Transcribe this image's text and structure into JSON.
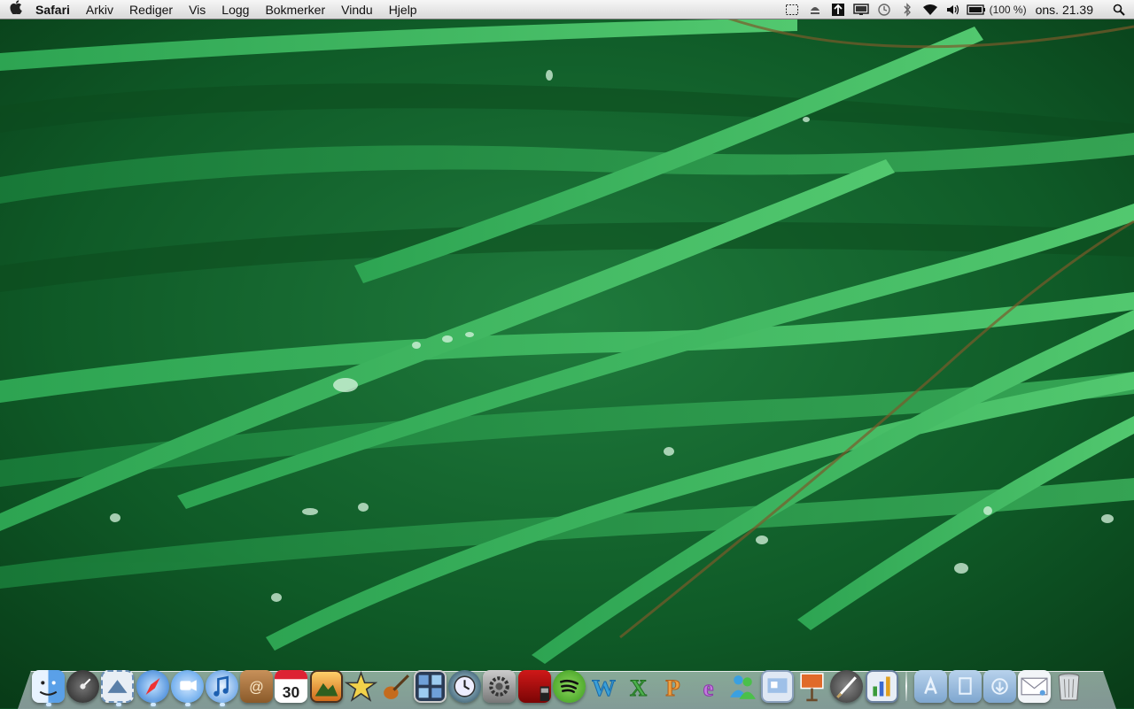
{
  "menubar": {
    "apple_icon": "apple-icon",
    "app_name": "Safari",
    "menus": [
      "Arkiv",
      "Rediger",
      "Vis",
      "Logg",
      "Bokmerker",
      "Vindu",
      "Hjelp"
    ],
    "status_icons": [
      "screen-capture-icon",
      "eject-icon",
      "dropbox-icon",
      "display-icon",
      "time-machine-icon",
      "bluetooth-icon",
      "wifi-icon",
      "volume-icon",
      "battery-icon"
    ],
    "battery_percent": "(100 %)",
    "clock": "ons. 21.39",
    "spotlight_icon": "spotlight-icon"
  },
  "dock": {
    "apps": [
      {
        "name": "finder",
        "icon": "finder-icon",
        "color": "#3d8fe0"
      },
      {
        "name": "dashboard",
        "icon": "dashboard-icon",
        "color": "#3a3a3a"
      },
      {
        "name": "mail",
        "icon": "mail-stamp-icon",
        "color": "#7da1c9"
      },
      {
        "name": "safari",
        "icon": "safari-compass-icon",
        "color": "#4b8ed8"
      },
      {
        "name": "ichat",
        "icon": "ichat-icon",
        "color": "#5fa6f0"
      },
      {
        "name": "itunes",
        "icon": "itunes-icon",
        "color": "#3c86d8"
      },
      {
        "name": "address-book",
        "icon": "address-book-icon",
        "color": "#b67d3a"
      },
      {
        "name": "ical",
        "icon": "calendar-icon",
        "color": "#e8e8e8",
        "label": "30"
      },
      {
        "name": "iphoto",
        "icon": "iphoto-icon",
        "color": "#7a5230"
      },
      {
        "name": "imovie",
        "icon": "imovie-star-icon",
        "color": "#5c4a2a"
      },
      {
        "name": "garageband",
        "icon": "guitar-icon",
        "color": "#b66a1e"
      },
      {
        "name": "spaces",
        "icon": "spaces-icon",
        "color": "#3a4f6f"
      },
      {
        "name": "time-machine",
        "icon": "time-machine-icon",
        "color": "#2f6b8f"
      },
      {
        "name": "system-preferences",
        "icon": "system-preferences-icon",
        "color": "#8a8a8a"
      },
      {
        "name": "photo-booth",
        "icon": "photo-booth-icon",
        "color": "#b01515"
      },
      {
        "name": "spotify",
        "icon": "spotify-icon",
        "color": "#5ab22e"
      },
      {
        "name": "word",
        "icon": "word-icon",
        "color": "#45a8d8"
      },
      {
        "name": "excel",
        "icon": "excel-icon",
        "color": "#4cb04c"
      },
      {
        "name": "powerpoint",
        "icon": "powerpoint-icon",
        "color": "#e48a2a"
      },
      {
        "name": "entourage",
        "icon": "entourage-icon",
        "color": "#b06ad0"
      },
      {
        "name": "messenger",
        "icon": "messenger-icon",
        "color": "#2e8fd6"
      },
      {
        "name": "preview-image",
        "icon": "preview-icon",
        "color": "#9fb6d3"
      },
      {
        "name": "keynote",
        "icon": "keynote-icon",
        "color": "#c75a2a"
      },
      {
        "name": "script-editor",
        "icon": "script-editor-icon",
        "color": "#404040"
      },
      {
        "name": "numbers",
        "icon": "numbers-icon",
        "color": "#3d6ec4"
      }
    ],
    "stacks": [
      {
        "name": "applications-folder",
        "icon": "applications-folder-icon",
        "color": "#8fb3d6"
      },
      {
        "name": "documents-folder",
        "icon": "documents-folder-icon",
        "color": "#8fb3d6"
      },
      {
        "name": "downloads-folder",
        "icon": "downloads-folder-icon",
        "color": "#8fb3d6"
      },
      {
        "name": "mail-stack",
        "icon": "envelope-icon",
        "color": "#e8eef4"
      },
      {
        "name": "trash",
        "icon": "trash-icon",
        "color": "#c8ccd0"
      }
    ]
  }
}
